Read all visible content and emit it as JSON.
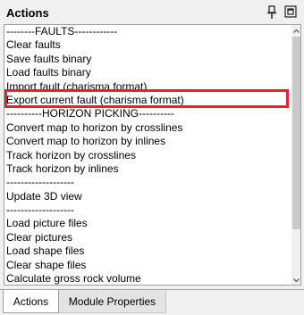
{
  "panel": {
    "title": "Actions"
  },
  "icons": {
    "pin": "pin-icon",
    "float": "float-window-icon",
    "scroll_up": "chevron-up-icon",
    "scroll_down": "chevron-down-icon"
  },
  "actions": [
    "--------FAULTS------------",
    "Clear faults",
    "Save faults binary",
    "Load faults binary",
    "Import fault (charisma format)",
    "Export current fault (charisma format)",
    "----------HORIZON PICKING----------",
    "Convert map to horizon by crosslines",
    "Convert map to horizon by inlines",
    "Track horizon by crosslines",
    "Track horizon by inlines",
    "-------------------",
    "Update 3D view",
    "-------------------",
    "Load picture files",
    "Clear pictures",
    "Load shape files",
    "Clear shape files",
    "Calculate gross rock volume"
  ],
  "highlighted_item": "Export current fault (charisma format)",
  "colors": {
    "highlight": "#e8222d"
  },
  "tabs": [
    {
      "label": "Actions",
      "active": true
    },
    {
      "label": "Module Properties",
      "active": false
    }
  ]
}
